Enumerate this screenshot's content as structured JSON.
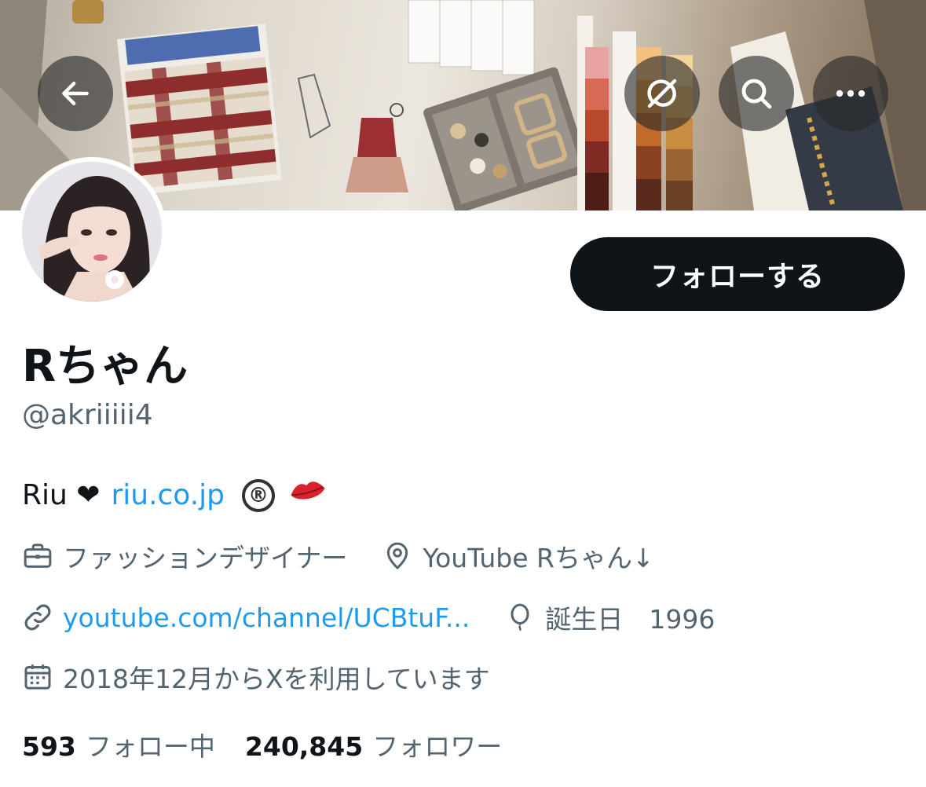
{
  "banner": {
    "photo_alt": "Fashion design desk with fabric swatches, sketches, buttons and color cards"
  },
  "nav": {
    "back_icon": "arrow-left-icon",
    "grok_icon": "grok-icon",
    "search_icon": "search-icon",
    "more_icon": "more-horizontal-icon"
  },
  "profile": {
    "follow_label": "フォローする",
    "display_name": "Rちゃん",
    "handle": "@akriiiii4",
    "bio": {
      "text": "Riu ❤︎",
      "link": "riu.co.jp",
      "registered": "®",
      "emoji": "💋"
    },
    "profession": "ファッションデザイナー",
    "location": "YouTube Rちゃん↓",
    "website": "youtube.com/channel/UCBtuF...",
    "birthday": "誕生日　1996",
    "joined": "2018年12月からXを利用しています",
    "following_count": "593",
    "following_label": "フォロー中",
    "followers_count": "240,845",
    "followers_label": "フォロワー"
  },
  "colors": {
    "text_primary": "#0f1419",
    "text_secondary": "#536471",
    "link": "#1d9bf0",
    "button_dark": "#0f1419",
    "nav_button_bg": "rgba(40,40,40,0.62)"
  }
}
